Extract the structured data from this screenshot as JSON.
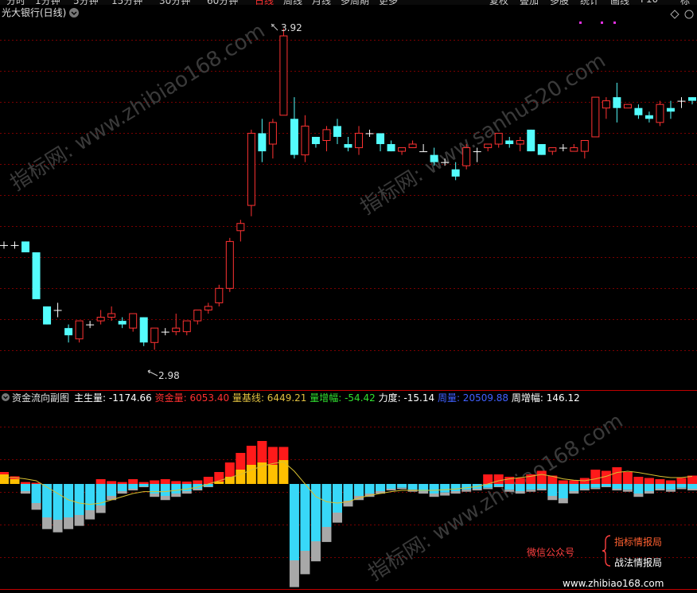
{
  "toolbar": {
    "left_items": [
      "分时",
      "1分钟",
      "5分钟",
      "15分钟",
      "30分钟",
      "60分钟",
      "日线",
      "周线",
      "月线",
      "多周期",
      "更多"
    ],
    "active": "日线",
    "right_items": [
      "复权",
      "叠加",
      "多股",
      "统计",
      "画线",
      "F10",
      "标记"
    ]
  },
  "main": {
    "title": "光大银行(日线)",
    "title_icon": "chevron-down-icon",
    "high_label": "3.92",
    "low_label": "2.98",
    "right_icons": [
      "diamond-icon",
      "settings-icon"
    ]
  },
  "sub": {
    "title": "资金流向副图",
    "indicators": [
      {
        "label": "主生量:",
        "value": "-1174.66",
        "color": "#ffffff"
      },
      {
        "label": "资金量:",
        "value": "6053.40",
        "color": "#ff3030"
      },
      {
        "label": "量基线:",
        "value": "6449.21",
        "color": "#e0c040"
      },
      {
        "label": "量增幅:",
        "value": "-54.42",
        "color": "#30e030"
      },
      {
        "label": "力度:",
        "value": "-15.14",
        "color": "#ffffff"
      },
      {
        "label": "周量:",
        "value": "20509.88",
        "color": "#4060ff"
      },
      {
        "label": "周增幅:",
        "value": "146.12",
        "color": "#ffffff"
      }
    ]
  },
  "watermarks": [
    "指标网: www.zhibiao168.com",
    "指标网: www.sanhu520.com",
    "指标网: www.zhibiao168.com"
  ],
  "promo": {
    "account_label": "微信公众号",
    "line1": "指标情报局",
    "line2": "战法情报局",
    "url": "www.zhibiao168.com"
  },
  "chart_data": [
    {
      "type": "candlestick",
      "title": "光大银行(日线)",
      "candles": [
        [
          3.32,
          3.33,
          3.31,
          3.32
        ],
        [
          3.32,
          3.33,
          3.31,
          3.32
        ],
        [
          3.33,
          3.33,
          3.3,
          3.3
        ],
        [
          3.3,
          3.3,
          3.17,
          3.17
        ],
        [
          3.15,
          3.15,
          3.1,
          3.1
        ],
        [
          3.14,
          3.16,
          3.12,
          3.14
        ],
        [
          3.09,
          3.1,
          3.05,
          3.07
        ],
        [
          3.06,
          3.11,
          3.05,
          3.11
        ],
        [
          3.1,
          3.11,
          3.09,
          3.1
        ],
        [
          3.11,
          3.14,
          3.1,
          3.12
        ],
        [
          3.12,
          3.15,
          3.11,
          3.13
        ],
        [
          3.11,
          3.12,
          3.09,
          3.1
        ],
        [
          3.09,
          3.13,
          3.08,
          3.13
        ],
        [
          3.12,
          3.12,
          3.04,
          3.05
        ],
        [
          3.05,
          3.09,
          3.03,
          3.09
        ],
        [
          3.08,
          3.09,
          3.07,
          3.08
        ],
        [
          3.08,
          3.13,
          3.07,
          3.09
        ],
        [
          3.08,
          3.11,
          3.07,
          3.11
        ],
        [
          3.11,
          3.14,
          3.1,
          3.14
        ],
        [
          3.14,
          3.16,
          3.13,
          3.15
        ],
        [
          3.16,
          3.21,
          3.15,
          3.2
        ],
        [
          3.2,
          3.34,
          3.19,
          3.33
        ],
        [
          3.36,
          3.39,
          3.33,
          3.38
        ],
        [
          3.43,
          3.64,
          3.4,
          3.63
        ],
        [
          3.63,
          3.67,
          3.55,
          3.58
        ],
        [
          3.6,
          3.67,
          3.56,
          3.66
        ],
        [
          3.68,
          3.92,
          3.68,
          3.9
        ],
        [
          3.67,
          3.73,
          3.56,
          3.57
        ],
        [
          3.57,
          3.68,
          3.55,
          3.65
        ],
        [
          3.62,
          3.62,
          3.59,
          3.6
        ],
        [
          3.61,
          3.65,
          3.58,
          3.64
        ],
        [
          3.65,
          3.67,
          3.6,
          3.62
        ],
        [
          3.6,
          3.62,
          3.58,
          3.59
        ],
        [
          3.59,
          3.65,
          3.57,
          3.63
        ],
        [
          3.63,
          3.64,
          3.62,
          3.63
        ],
        [
          3.63,
          3.63,
          3.58,
          3.6
        ],
        [
          3.6,
          3.61,
          3.58,
          3.58
        ],
        [
          3.58,
          3.59,
          3.57,
          3.59
        ],
        [
          3.59,
          3.61,
          3.59,
          3.6
        ],
        [
          3.58,
          3.6,
          3.58,
          3.58
        ],
        [
          3.57,
          3.59,
          3.54,
          3.55
        ],
        [
          3.55,
          3.56,
          3.54,
          3.55
        ],
        [
          3.53,
          3.55,
          3.5,
          3.51
        ],
        [
          3.54,
          3.6,
          3.53,
          3.59
        ],
        [
          3.58,
          3.59,
          3.55,
          3.58
        ],
        [
          3.59,
          3.6,
          3.58,
          3.6
        ],
        [
          3.6,
          3.63,
          3.59,
          3.63
        ],
        [
          3.61,
          3.62,
          3.59,
          3.6
        ],
        [
          3.6,
          3.62,
          3.58,
          3.61
        ],
        [
          3.64,
          3.64,
          3.58,
          3.58
        ],
        [
          3.6,
          3.6,
          3.57,
          3.57
        ],
        [
          3.58,
          3.59,
          3.57,
          3.59
        ],
        [
          3.59,
          3.6,
          3.58,
          3.59
        ],
        [
          3.58,
          3.6,
          3.58,
          3.59
        ],
        [
          3.58,
          3.61,
          3.56,
          3.61
        ],
        [
          3.62,
          3.73,
          3.62,
          3.73
        ],
        [
          3.7,
          3.73,
          3.67,
          3.72
        ],
        [
          3.73,
          3.77,
          3.66,
          3.7
        ],
        [
          3.7,
          3.71,
          3.7,
          3.71
        ],
        [
          3.7,
          3.71,
          3.67,
          3.68
        ],
        [
          3.68,
          3.69,
          3.66,
          3.67
        ],
        [
          3.66,
          3.72,
          3.65,
          3.71
        ],
        [
          3.7,
          3.72,
          3.67,
          3.69
        ],
        [
          3.72,
          3.73,
          3.7,
          3.72
        ],
        [
          3.73,
          3.73,
          3.71,
          3.72
        ]
      ],
      "annotations": {
        "high": 3.92,
        "low": 2.98
      }
    },
    {
      "type": "bar",
      "title": "资金流向副图",
      "series": [
        {
          "name": "主生量",
          "values": [
            20,
            10,
            -15,
            -40,
            -70,
            -75,
            -70,
            -65,
            -55,
            -45,
            -25,
            -15,
            -10,
            -5,
            -20,
            -25,
            -20,
            -15,
            -10,
            -5,
            5,
            15,
            30,
            40,
            45,
            40,
            50,
            -160,
            -140,
            -120,
            -90,
            -60,
            -35,
            -25,
            -20,
            -15,
            -10,
            -8,
            -12,
            -15,
            -20,
            -18,
            -15,
            -12,
            -10,
            -8,
            -5,
            -12,
            -15,
            -12,
            -10,
            -25,
            -30,
            -15,
            -10,
            -8,
            -5,
            -10,
            -12,
            -20,
            -15,
            -10,
            -12,
            -8,
            -10
          ]
        },
        {
          "name": "资金量",
          "values": [
            10,
            12,
            8,
            5,
            0,
            0,
            0,
            0,
            0,
            20,
            12,
            8,
            20,
            8,
            15,
            20,
            12,
            10,
            15,
            30,
            40,
            60,
            70,
            80,
            90,
            75,
            55,
            0,
            0,
            0,
            0,
            0,
            0,
            0,
            0,
            0,
            0,
            0,
            0,
            0,
            0,
            0,
            0,
            0,
            0,
            40,
            40,
            30,
            25,
            40,
            55,
            35,
            15,
            15,
            25,
            60,
            55,
            70,
            50,
            30,
            25,
            20,
            15,
            25,
            35
          ]
        },
        {
          "name": "量基线",
          "values": [
            10,
            10,
            8,
            5,
            -5,
            -15,
            -25,
            -30,
            -32,
            -30,
            -25,
            -20,
            -15,
            -12,
            -12,
            -12,
            -10,
            -8,
            -5,
            0,
            5,
            10,
            15,
            22,
            28,
            32,
            35,
            20,
            0,
            -20,
            -28,
            -30,
            -28,
            -22,
            -18,
            -15,
            -12,
            -10,
            -10,
            -10,
            -10,
            -9,
            -8,
            -6,
            -4,
            0,
            5,
            8,
            10,
            12,
            15,
            12,
            8,
            6,
            5,
            8,
            12,
            18,
            20,
            18,
            15,
            12,
            10,
            10,
            12
          ]
        }
      ]
    }
  ]
}
